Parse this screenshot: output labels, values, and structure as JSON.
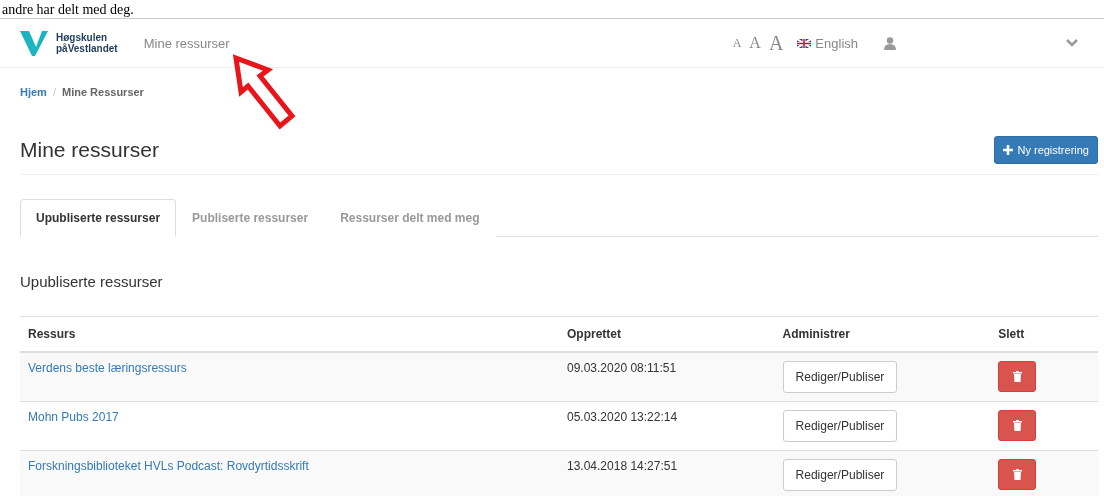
{
  "document_caption": "andre har delt med deg.",
  "navbar": {
    "logo_line_1": "Høgskulen",
    "logo_line_2": "påVestlandet",
    "title": "Mine ressurser",
    "font_sizes": [
      "A",
      "A",
      "A"
    ],
    "language": "English"
  },
  "breadcrumb_separator": "/",
  "breadcrumb": [
    {
      "label": "Hjem",
      "kind": "link"
    },
    {
      "label": "Mine Ressurser",
      "kind": "current"
    }
  ],
  "page_title": "Mine ressurser",
  "new_button": "Ny registrering",
  "tabs": [
    {
      "label": "Upubliserte ressurser",
      "selected": true
    },
    {
      "label": "Publiserte ressurser",
      "selected": false
    },
    {
      "label": "Ressurser delt med meg",
      "selected": false
    }
  ],
  "section_title": "Upubliserte ressurser",
  "table": {
    "columns": [
      "Ressurs",
      "Opprettet",
      "Administrer",
      "Slett"
    ],
    "rows": [
      {
        "name": "Verdens beste læringsressurs",
        "created": "09.03.2020 08:11:51",
        "action": "Rediger/Publiser"
      },
      {
        "name": "Mohn Pubs 2017",
        "created": "05.03.2020 13:22:14",
        "action": "Rediger/Publiser"
      },
      {
        "name": "Forskningsbiblioteket HVLs Podcast: Rovdyrtidsskrift",
        "created": "13.04.2018 14:27:51",
        "action": "Rediger/Publiser"
      }
    ]
  }
}
